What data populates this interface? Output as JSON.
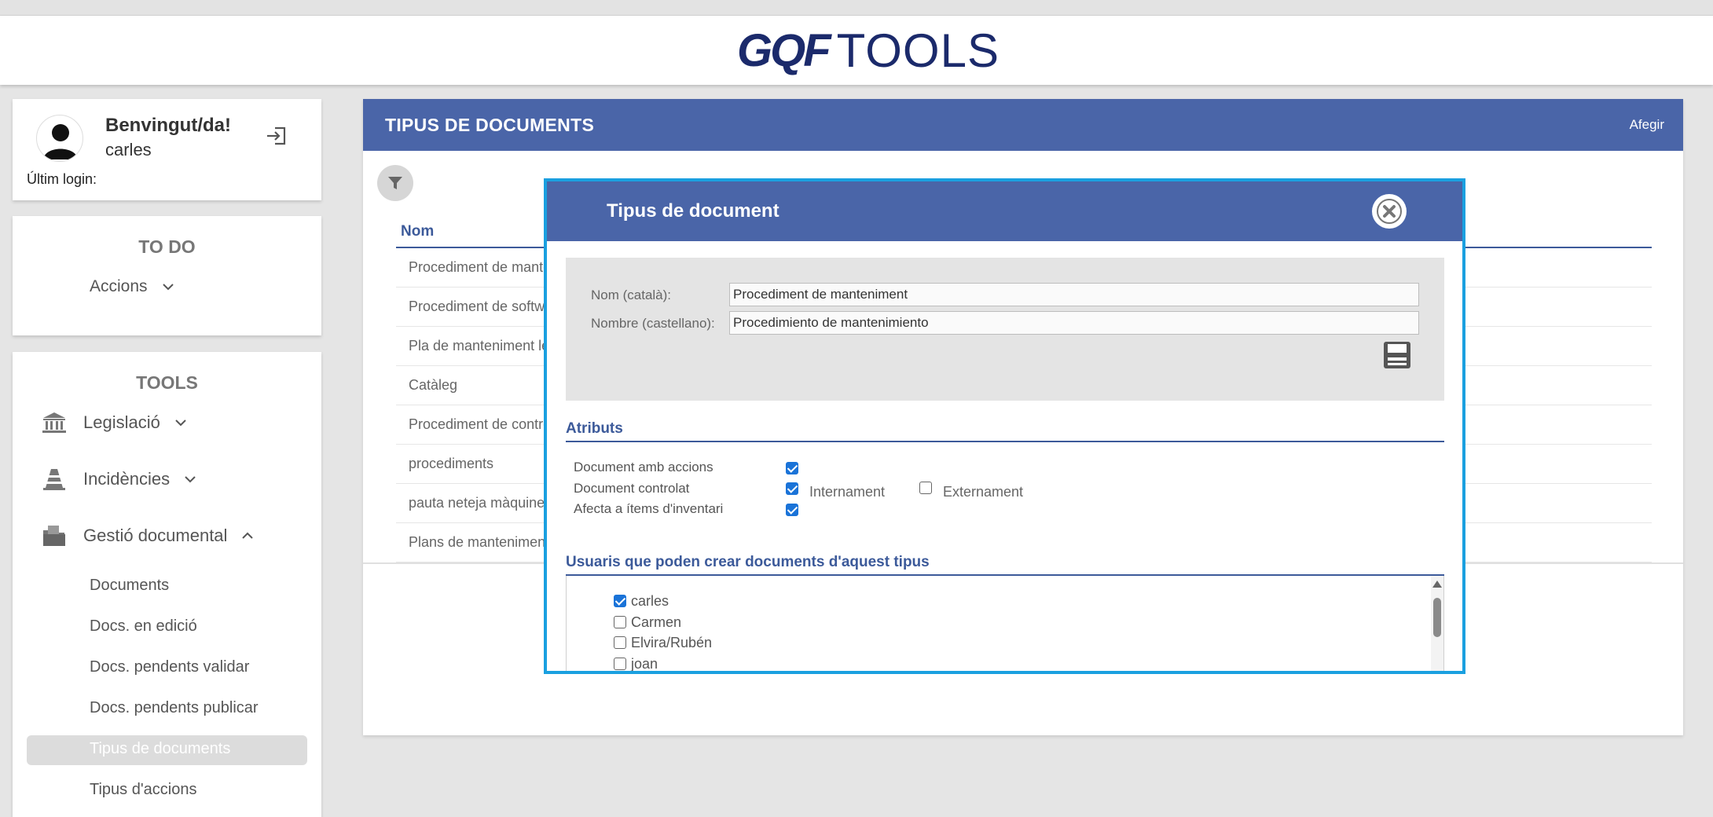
{
  "header": {
    "logo_left": "GQF",
    "logo_right": "TOOLS"
  },
  "user": {
    "welcome": "Benvingut/da!",
    "name": "carles",
    "last_login": "Últim login:"
  },
  "todo": {
    "title": "TO DO",
    "accions": "Accions"
  },
  "tools": {
    "title": "TOOLS",
    "legislacio": "Legislació",
    "incidencies": "Incidències",
    "gestio": "Gestió documental",
    "subitems": [
      "Documents",
      "Docs. en edició",
      "Docs. pendents validar",
      "Docs. pendents publicar",
      "Tipus de documents",
      "Tipus d'accions"
    ]
  },
  "main": {
    "title": "TIPUS DE DOCUMENTS",
    "add_label": "Afegir",
    "column_name": "Nom",
    "rows": [
      "Procediment de mante",
      "Procediment de softwa",
      "Pla de manteniment le",
      "Catàleg",
      "Procediment de contro",
      "procediments",
      "pauta neteja màquines",
      "Plans de manteniment"
    ]
  },
  "modal": {
    "title": "Tipus de document",
    "nom_label": "Nom (català):",
    "nom_value": "Procediment de manteniment",
    "nombre_label": "Nombre (castellano):",
    "nombre_value": "Procedimiento de mantenimiento",
    "atributs_title": "Atributs",
    "attr_accions": "Document amb accions",
    "attr_controlat": "Document controlat",
    "attr_afecta": "Afecta a ítems d'inventari",
    "internament": "Internament",
    "externament": "Externament",
    "users_title": "Usuaris que poden crear documents d'aquest tipus",
    "users": [
      {
        "name": "carles",
        "checked": true
      },
      {
        "name": "Carmen",
        "checked": false
      },
      {
        "name": "Elvira/Rubén",
        "checked": false
      },
      {
        "name": "joan",
        "checked": false
      }
    ]
  },
  "colors": {
    "primary": "#4a65a8",
    "modal_border": "#1aa0e0",
    "logo": "#1b2a6b"
  }
}
